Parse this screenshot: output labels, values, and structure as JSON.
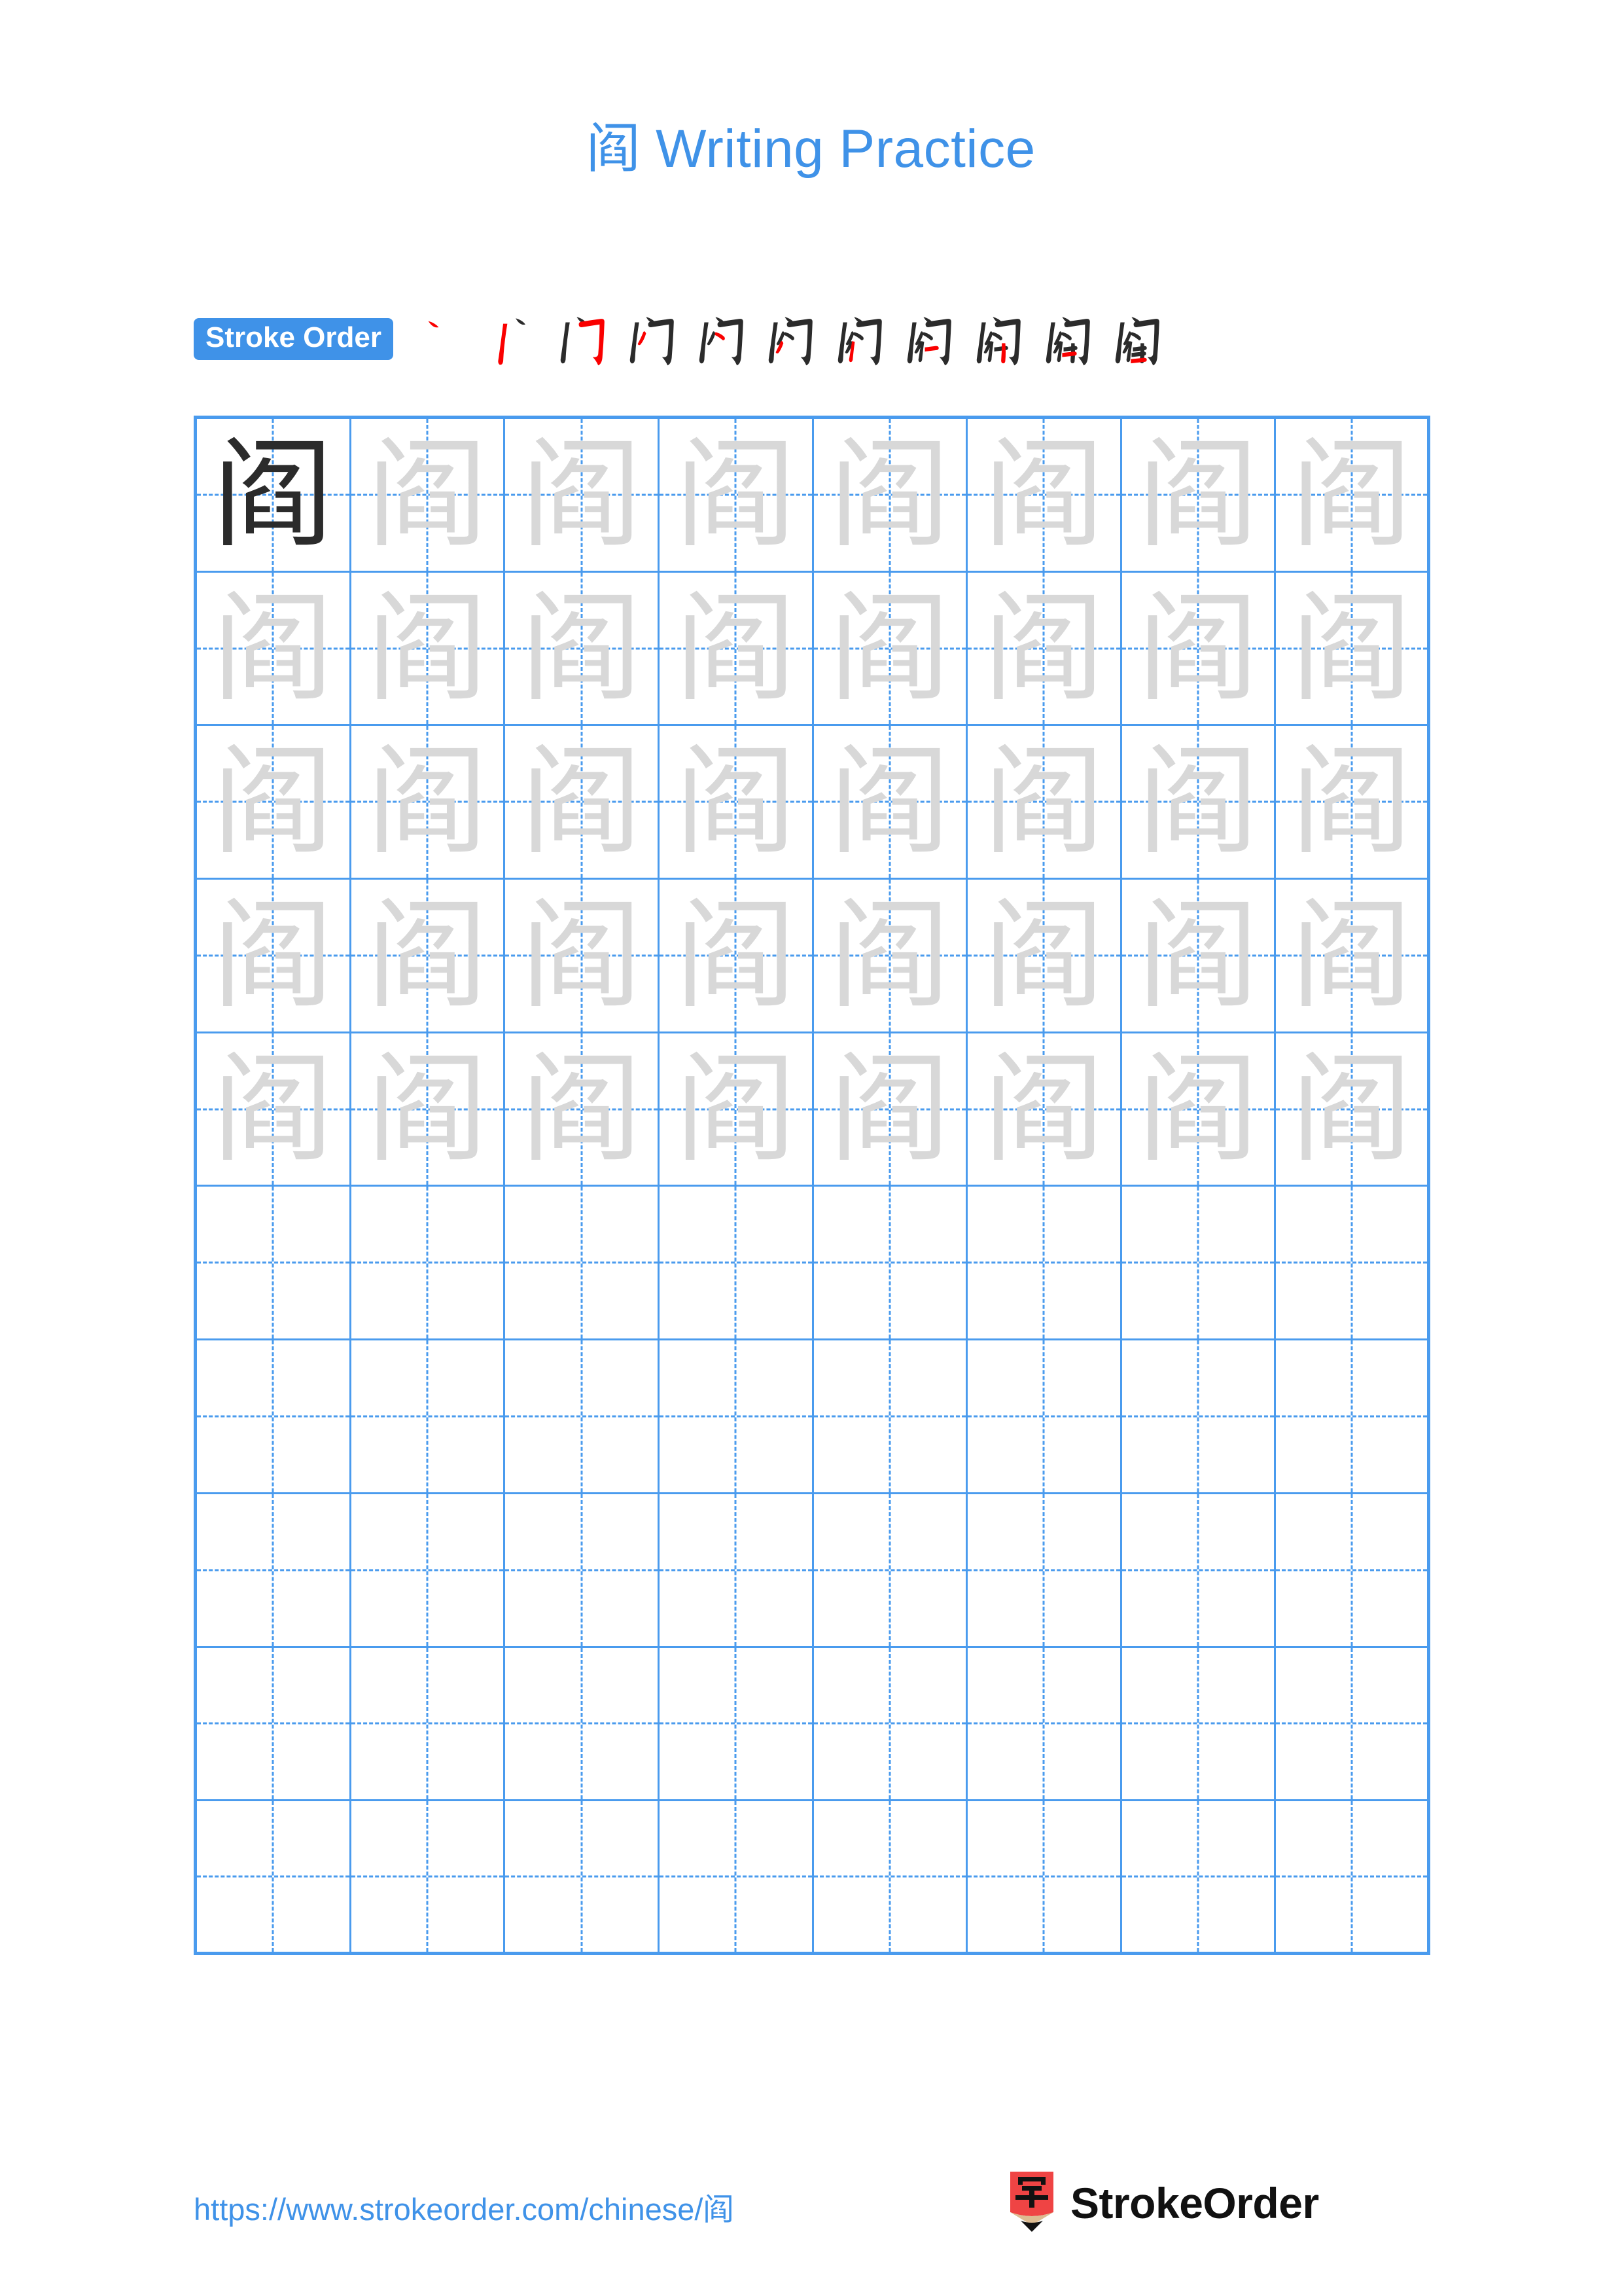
{
  "document": {
    "character": "阎",
    "title": "阎 Writing Practice",
    "title_character": "阎",
    "title_suffix": " Writing Practice"
  },
  "stroke_order": {
    "badge_label": "Stroke Order",
    "total_steps": 11,
    "new_stroke_color": "#fa0000",
    "existing_stroke_color": "#2b2b2b",
    "steps": [
      {
        "index": 1,
        "partial": "丶"
      },
      {
        "index": 2,
        "partial": "丬"
      },
      {
        "index": 3,
        "partial": "门"
      },
      {
        "index": 4,
        "partial": "门"
      },
      {
        "index": 5,
        "partial": "闪"
      },
      {
        "index": 6,
        "partial": "闪"
      },
      {
        "index": 7,
        "partial": "闷"
      },
      {
        "index": 8,
        "partial": "阁"
      },
      {
        "index": 9,
        "partial": "阎"
      },
      {
        "index": 10,
        "partial": "阎"
      },
      {
        "index": 11,
        "partial": "阎"
      }
    ]
  },
  "practice_grid": {
    "columns": 8,
    "rows": 10,
    "grid_line_color": "#4a9bee",
    "guide_line_style": "dashed",
    "solid_character_color": "#2b2b2b",
    "trace_character_color": "#d8d8d8",
    "rows_data": [
      {
        "row": 1,
        "cells": [
          "solid",
          "trace",
          "trace",
          "trace",
          "trace",
          "trace",
          "trace",
          "trace"
        ]
      },
      {
        "row": 2,
        "cells": [
          "trace",
          "trace",
          "trace",
          "trace",
          "trace",
          "trace",
          "trace",
          "trace"
        ]
      },
      {
        "row": 3,
        "cells": [
          "trace",
          "trace",
          "trace",
          "trace",
          "trace",
          "trace",
          "trace",
          "trace"
        ]
      },
      {
        "row": 4,
        "cells": [
          "trace",
          "trace",
          "trace",
          "trace",
          "trace",
          "trace",
          "trace",
          "trace"
        ]
      },
      {
        "row": 5,
        "cells": [
          "trace",
          "trace",
          "trace",
          "trace",
          "trace",
          "trace",
          "trace",
          "trace"
        ]
      },
      {
        "row": 6,
        "cells": [
          "empty",
          "empty",
          "empty",
          "empty",
          "empty",
          "empty",
          "empty",
          "empty"
        ]
      },
      {
        "row": 7,
        "cells": [
          "empty",
          "empty",
          "empty",
          "empty",
          "empty",
          "empty",
          "empty",
          "empty"
        ]
      },
      {
        "row": 8,
        "cells": [
          "empty",
          "empty",
          "empty",
          "empty",
          "empty",
          "empty",
          "empty",
          "empty"
        ]
      },
      {
        "row": 9,
        "cells": [
          "empty",
          "empty",
          "empty",
          "empty",
          "empty",
          "empty",
          "empty",
          "empty"
        ]
      },
      {
        "row": 10,
        "cells": [
          "empty",
          "empty",
          "empty",
          "empty",
          "empty",
          "empty",
          "empty",
          "empty"
        ]
      }
    ]
  },
  "footer": {
    "url_prefix": "https://www.strokeorder.com/chinese/",
    "url_character": "阎",
    "url_full": "https://www.strokeorder.com/chinese/阎",
    "brand_name": "StrokeOrder",
    "brand_icon_character": "字",
    "brand_icon_body_color": "#ef4444",
    "brand_icon_wood_color": "#ddbb91",
    "brand_icon_tip_color": "#111111"
  },
  "theme": {
    "accent_blue": "#3f92e8",
    "grid_blue": "#4a9bee",
    "red": "#fa0000",
    "background": "#ffffff"
  }
}
